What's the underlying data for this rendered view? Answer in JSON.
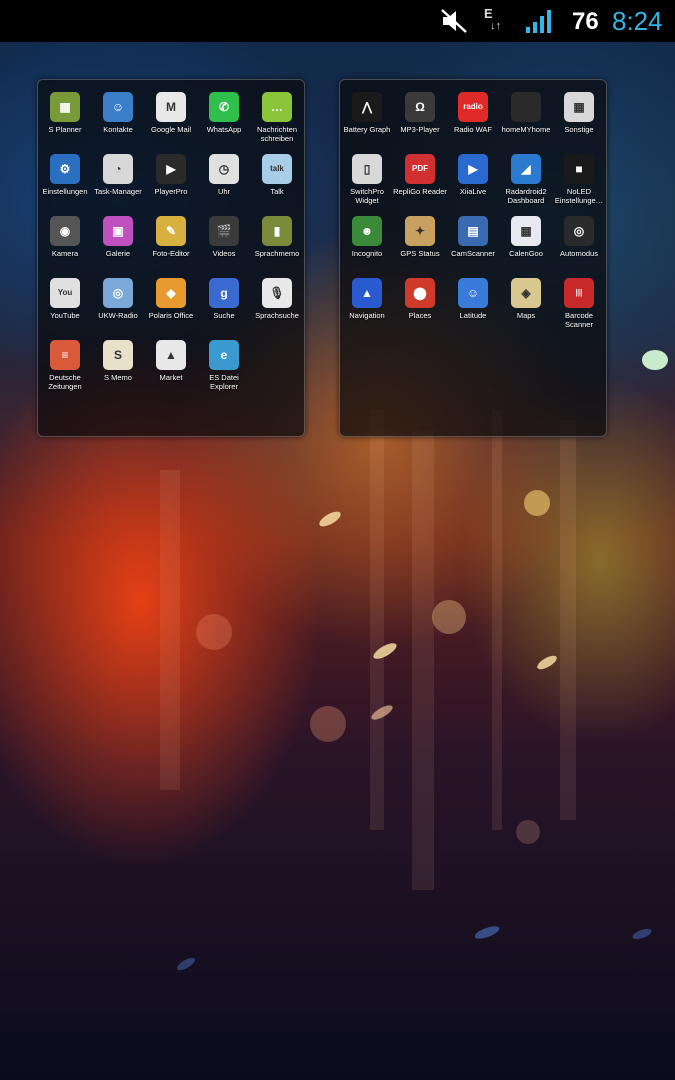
{
  "status_bar": {
    "mute_icon": "speaker-muted-icon",
    "data_icon": "edge-data-icon",
    "data_letter": "E",
    "signal_icon": "signal-bars-icon",
    "battery_level": "76",
    "time": "8:24",
    "time_color": "#33b5e5"
  },
  "folders": [
    {
      "apps": [
        {
          "label": "S Planner",
          "icon": "calendar-icon",
          "color": "#7a9a3a",
          "glyph": "▦"
        },
        {
          "label": "Kontakte",
          "icon": "contacts-icon",
          "color": "#3a7fc8",
          "glyph": "☺"
        },
        {
          "label": "Google Mail",
          "icon": "gmail-icon",
          "color": "#e8e8e8",
          "glyph": "M"
        },
        {
          "label": "WhatsApp",
          "icon": "whatsapp-icon",
          "color": "#2fbf4a",
          "glyph": "✆"
        },
        {
          "label": "Nachrichten schreiben",
          "icon": "messages-icon",
          "color": "#8ac53a",
          "glyph": "…"
        },
        {
          "label": "Einstellungen",
          "icon": "settings-gear-icon",
          "color": "#2a6fc0",
          "glyph": "⚙"
        },
        {
          "label": "Task-Manager",
          "icon": "task-manager-pie-icon",
          "color": "#d8d8d8",
          "glyph": "◔"
        },
        {
          "label": "PlayerPro",
          "icon": "playerpro-icon",
          "color": "#2a2a2a",
          "glyph": "▶"
        },
        {
          "label": "Uhr",
          "icon": "clock-icon",
          "color": "#e0e0e0",
          "glyph": "◷"
        },
        {
          "label": "Talk",
          "icon": "talk-icon",
          "color": "#a8cde8",
          "glyph": "talk"
        },
        {
          "label": "Kamera",
          "icon": "camera-icon",
          "color": "#555555",
          "glyph": "◉"
        },
        {
          "label": "Galerie",
          "icon": "gallery-icon",
          "color": "#c050c0",
          "glyph": "▣"
        },
        {
          "label": "Foto-Editor",
          "icon": "photo-editor-icon",
          "color": "#d8b040",
          "glyph": "✎"
        },
        {
          "label": "Videos",
          "icon": "videos-clapper-icon",
          "color": "#3a3a3a",
          "glyph": "🎬"
        },
        {
          "label": "Sprachmemo",
          "icon": "voice-memo-icon",
          "color": "#7a8a3a",
          "glyph": "▮"
        },
        {
          "label": "YouTube",
          "icon": "youtube-icon",
          "color": "#e0e0e0",
          "glyph": "You"
        },
        {
          "label": "UKW-Radio",
          "icon": "fm-radio-icon",
          "color": "#7aa8d8",
          "glyph": "◎"
        },
        {
          "label": "Polaris Office",
          "icon": "polaris-office-icon",
          "color": "#e89a30",
          "glyph": "◆"
        },
        {
          "label": "Suche",
          "icon": "google-search-icon",
          "color": "#3a6ad0",
          "glyph": "g"
        },
        {
          "label": "Sprachsuche",
          "icon": "voice-search-mic-icon",
          "color": "#e8e8e8",
          "glyph": "🎙"
        },
        {
          "label": "Deutsche Zeitungen",
          "icon": "newspapers-icon",
          "color": "#d85a3a",
          "glyph": "≡"
        },
        {
          "label": "S Memo",
          "icon": "s-memo-icon",
          "color": "#e8e0c8",
          "glyph": "S"
        },
        {
          "label": "Market",
          "icon": "market-bag-icon",
          "color": "#e8e8e8",
          "glyph": "▲"
        },
        {
          "label": "ES Datei Explorer",
          "icon": "es-file-explorer-icon",
          "color": "#3a9ad0",
          "glyph": "e"
        }
      ]
    },
    {
      "apps": [
        {
          "label": "Battery Graph",
          "icon": "battery-graph-icon",
          "color": "#1a1a1a",
          "glyph": "⋀"
        },
        {
          "label": "MP3-Player",
          "icon": "headphones-icon",
          "color": "#3a3a3a",
          "glyph": "Ω"
        },
        {
          "label": "Radio WAF",
          "icon": "radio-waf-icon",
          "color": "#e02a2a",
          "glyph": "radio"
        },
        {
          "label": "homeMYhome",
          "icon": "homemyhome-icon",
          "color": "#2a2a2a",
          "glyph": ""
        },
        {
          "label": "Sonstige",
          "icon": "folder-misc-icon",
          "color": "#d8d8d8",
          "glyph": "▦"
        },
        {
          "label": "SwitchPro Widget",
          "icon": "switchpro-icon",
          "color": "#d8d8d8",
          "glyph": "▯"
        },
        {
          "label": "RepliGo Reader",
          "icon": "pdf-reader-icon",
          "color": "#d03030",
          "glyph": "PDF"
        },
        {
          "label": "XiiaLive",
          "icon": "xiialive-icon",
          "color": "#2a6ad0",
          "glyph": "▶"
        },
        {
          "label": "Radardroid2 Dashboard",
          "icon": "radardroid-icon",
          "color": "#2a7ad0",
          "glyph": "◢"
        },
        {
          "label": "NoLED Einstellunge…",
          "icon": "noled-icon",
          "color": "#1a1a1a",
          "glyph": "■"
        },
        {
          "label": "Incognito",
          "icon": "incognito-icon",
          "color": "#3a8a3a",
          "glyph": "☻"
        },
        {
          "label": "GPS Status",
          "icon": "gps-status-icon",
          "color": "#c8a060",
          "glyph": "✦"
        },
        {
          "label": "CamScanner",
          "icon": "camscanner-icon",
          "color": "#3a6ab0",
          "glyph": "▤"
        },
        {
          "label": "CalenGoo",
          "icon": "calengoo-icon",
          "color": "#e8e8f0",
          "glyph": "▦"
        },
        {
          "label": "Automodus",
          "icon": "car-mode-steering-icon",
          "color": "#2a2a2a",
          "glyph": "◎"
        },
        {
          "label": "Navigation",
          "icon": "navigation-arrow-icon",
          "color": "#2a5ad0",
          "glyph": "▲"
        },
        {
          "label": "Places",
          "icon": "places-pin-icon",
          "color": "#d03a2a",
          "glyph": "⬤"
        },
        {
          "label": "Latitude",
          "icon": "latitude-icon",
          "color": "#3a7ad8",
          "glyph": "☺"
        },
        {
          "label": "Maps",
          "icon": "maps-icon",
          "color": "#d8c890",
          "glyph": "◈"
        },
        {
          "label": "Barcode Scanner",
          "icon": "barcode-scanner-icon",
          "color": "#c82a2a",
          "glyph": "|||"
        }
      ]
    }
  ]
}
